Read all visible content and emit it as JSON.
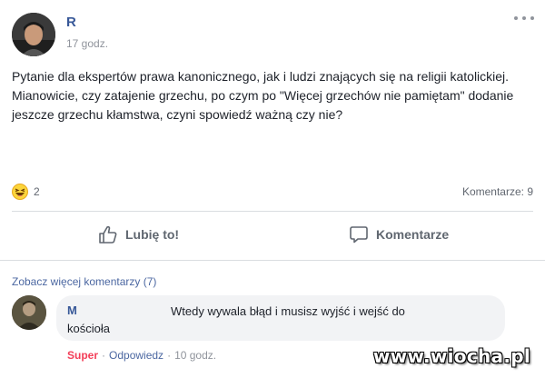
{
  "post": {
    "author": "R",
    "time": "17 godz.",
    "paragraphs": [
      "Pytanie dla ekspertów prawa kanonicznego, jak i ludzi znających się na religii katolickiej.",
      "Mianowicie, czy zatajenie grzechu, po czym po \"Więcej grzechów nie pamiętam\" dodanie jeszcze grzechu kłamstwa, czyni spowiedź ważną czy nie?"
    ],
    "reaction_count": "2",
    "reaction_icon": "haha-emoji-icon",
    "comment_count": "Komentarze: 9"
  },
  "actions": {
    "like_label": "Lubię to!",
    "comment_label": "Komentarze"
  },
  "comments": {
    "view_more": "Zobacz więcej komentarzy (7)",
    "items": [
      {
        "author": "M",
        "text": "Wtedy wywala błąd i musisz wyjść i wejść do kościoła",
        "reaction": "Super",
        "reply": "Odpowiedz",
        "time": "10 godz."
      }
    ]
  },
  "watermark": "www.wiocha.pl",
  "colors": {
    "link": "#385898",
    "secondary": "#90949c",
    "bubble": "#f2f3f5",
    "super": "#f33e58"
  }
}
